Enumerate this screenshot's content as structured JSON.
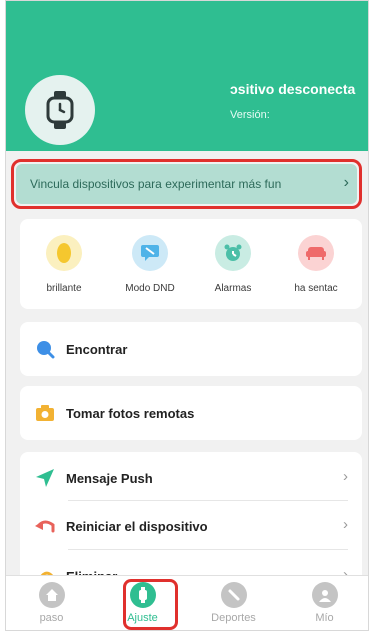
{
  "header": {
    "device_status": "ɔsitivo desconecta",
    "version_label": "Versión:"
  },
  "banner": {
    "text": "Vincula dispositivos para experimentar más fun",
    "chevron": "›"
  },
  "quick_actions": [
    {
      "label": "brillante",
      "icon": "brightness-icon",
      "color": "#f7d648",
      "bg": "#fbf0bf"
    },
    {
      "label": "Modo DND",
      "icon": "dnd-icon",
      "color": "#4fb3e8",
      "bg": "#cde9f7"
    },
    {
      "label": "Alarmas",
      "icon": "alarm-icon",
      "color": "#4cbfa8",
      "bg": "#c9ece3"
    },
    {
      "label": "ha sentac",
      "icon": "sedentary-icon",
      "color": "#ef6a6a",
      "bg": "#fbd3d3"
    }
  ],
  "rows": {
    "find": "Encontrar",
    "remote_photo": "Tomar fotos remotas"
  },
  "list": [
    {
      "label": "Mensaje Push",
      "icon": "push-icon"
    },
    {
      "label": "Reiniciar el dispositivo",
      "icon": "restart-icon"
    },
    {
      "label": "Eliminar",
      "icon": "delete-icon"
    }
  ],
  "tabs": [
    {
      "label": "paso",
      "icon": "home-icon"
    },
    {
      "label": "Ajuste",
      "icon": "watch-icon",
      "active": true
    },
    {
      "label": "Deportes",
      "icon": "sports-icon"
    },
    {
      "label": "Mío",
      "icon": "profile-icon"
    }
  ],
  "colors": {
    "accent": "#2fbe91",
    "highlight_outline": "#e0302d"
  }
}
